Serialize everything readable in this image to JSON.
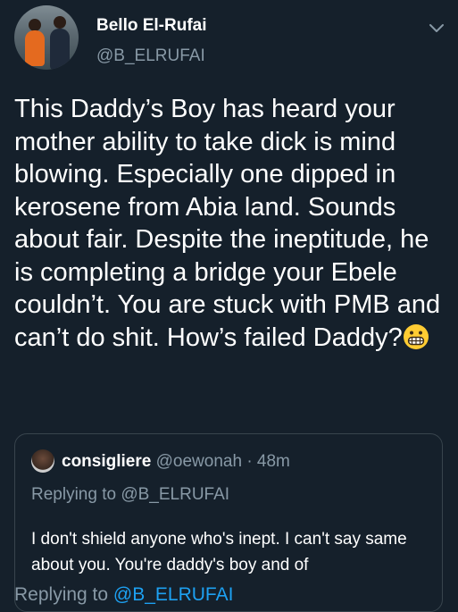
{
  "tweet": {
    "display_name": "Bello El-Rufai",
    "handle": "@B_ELRUFAI",
    "text": "This Daddy’s Boy has heard your mother ability to take dick is mind blowing. Especially one dipped in kerosene from Abia land. Sounds about fair. Despite the ineptitude, he is completing a bridge your Ebele couldn’t. You are stuck with PMB and can’t do shit. How’s failed Daddy?",
    "emoji": "grimacing-face"
  },
  "quoted_tweet": {
    "display_name": "consigliere",
    "handle": "@oewonah",
    "separator": "·",
    "time": "48m",
    "replying_prefix": "Replying to",
    "replying_to": "@B_ELRUFAI",
    "text": "I don't shield anyone who's inept. I can't say same about you. You're daddy's boy and of"
  },
  "footer": {
    "replying_prefix": "Replying to",
    "replying_to": "@B_ELRUFAI"
  },
  "colors": {
    "background": "#15202b",
    "secondary_text": "#8899a6",
    "accent": "#1da1f2",
    "border": "#38444d"
  }
}
